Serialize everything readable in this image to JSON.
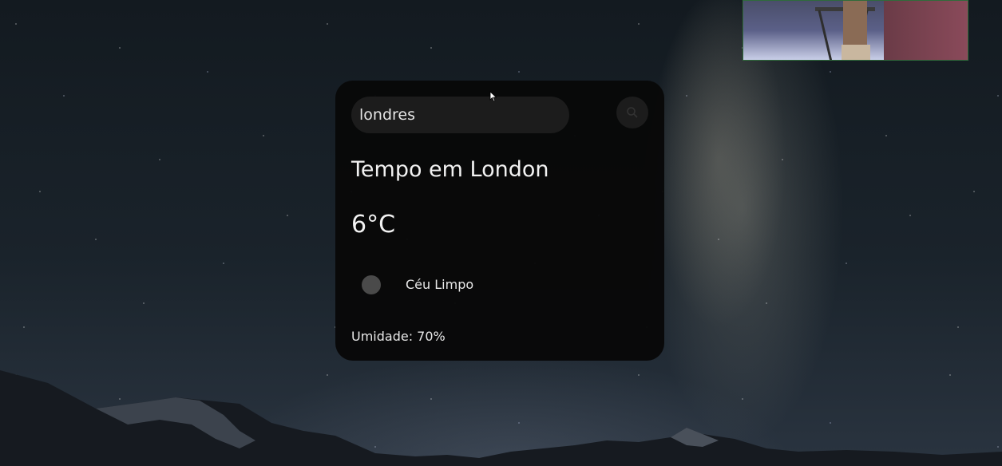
{
  "weather": {
    "search": {
      "value": "londres",
      "icon": "search-icon"
    },
    "title": "Tempo em London",
    "temperature": "6°C",
    "condition": {
      "icon": "weather-condition-icon",
      "description": "Céu Limpo"
    },
    "humidity": "Umidade: 70%"
  },
  "colors": {
    "card_background": "#080808",
    "input_background": "#1c1c1c",
    "text": "#f2f2f2"
  }
}
